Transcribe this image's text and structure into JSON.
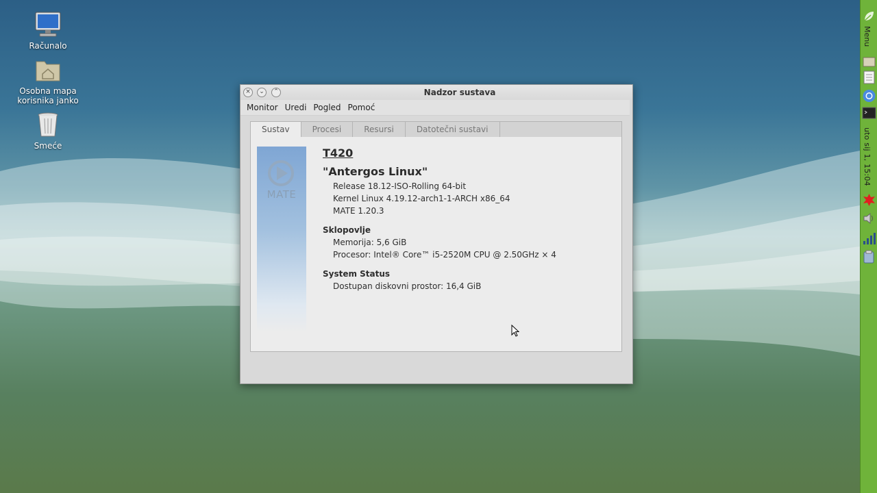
{
  "desktop": {
    "icons": [
      {
        "label": "Računalo",
        "icon": "computer-icon"
      },
      {
        "label": "Osobna mapa korisnika janko",
        "icon": "home-folder-icon"
      },
      {
        "label": "Smeće",
        "icon": "trash-icon"
      }
    ]
  },
  "panel": {
    "menu_label": "Menu",
    "clock": "uto sij 1, 15:04",
    "launchers": [
      "files-icon",
      "text-editor-icon",
      "chromium-icon",
      "terminal-icon"
    ],
    "tray": [
      "updates-icon",
      "volume-icon",
      "network-icon",
      "clipboard-icon"
    ],
    "color": "#6fb33a"
  },
  "window": {
    "title": "Nadzor sustava",
    "menus": [
      "Monitor",
      "Uredi",
      "Pogled",
      "Pomoć"
    ],
    "tabs": [
      "Sustav",
      "Procesi",
      "Resursi",
      "Datotečni sustavi"
    ],
    "active_tab": "Sustav",
    "system": {
      "logo_text": "MATE",
      "hostname": "T420",
      "distro": "\"Antergos Linux\"",
      "release": "Release 18.12-ISO-Rolling 64-bit",
      "kernel": "Kernel Linux 4.19.12-arch1-1-ARCH x86_64",
      "desktop_version": "MATE 1.20.3",
      "hardware_heading": "Sklopovlje",
      "memory": "Memorija:  5,6 GiB",
      "processor": "Procesor:  Intel® Core™ i5-2520M CPU @ 2.50GHz × 4",
      "status_heading": "System Status",
      "disk": "Dostupan diskovni prostor:  16,4 GiB"
    }
  }
}
